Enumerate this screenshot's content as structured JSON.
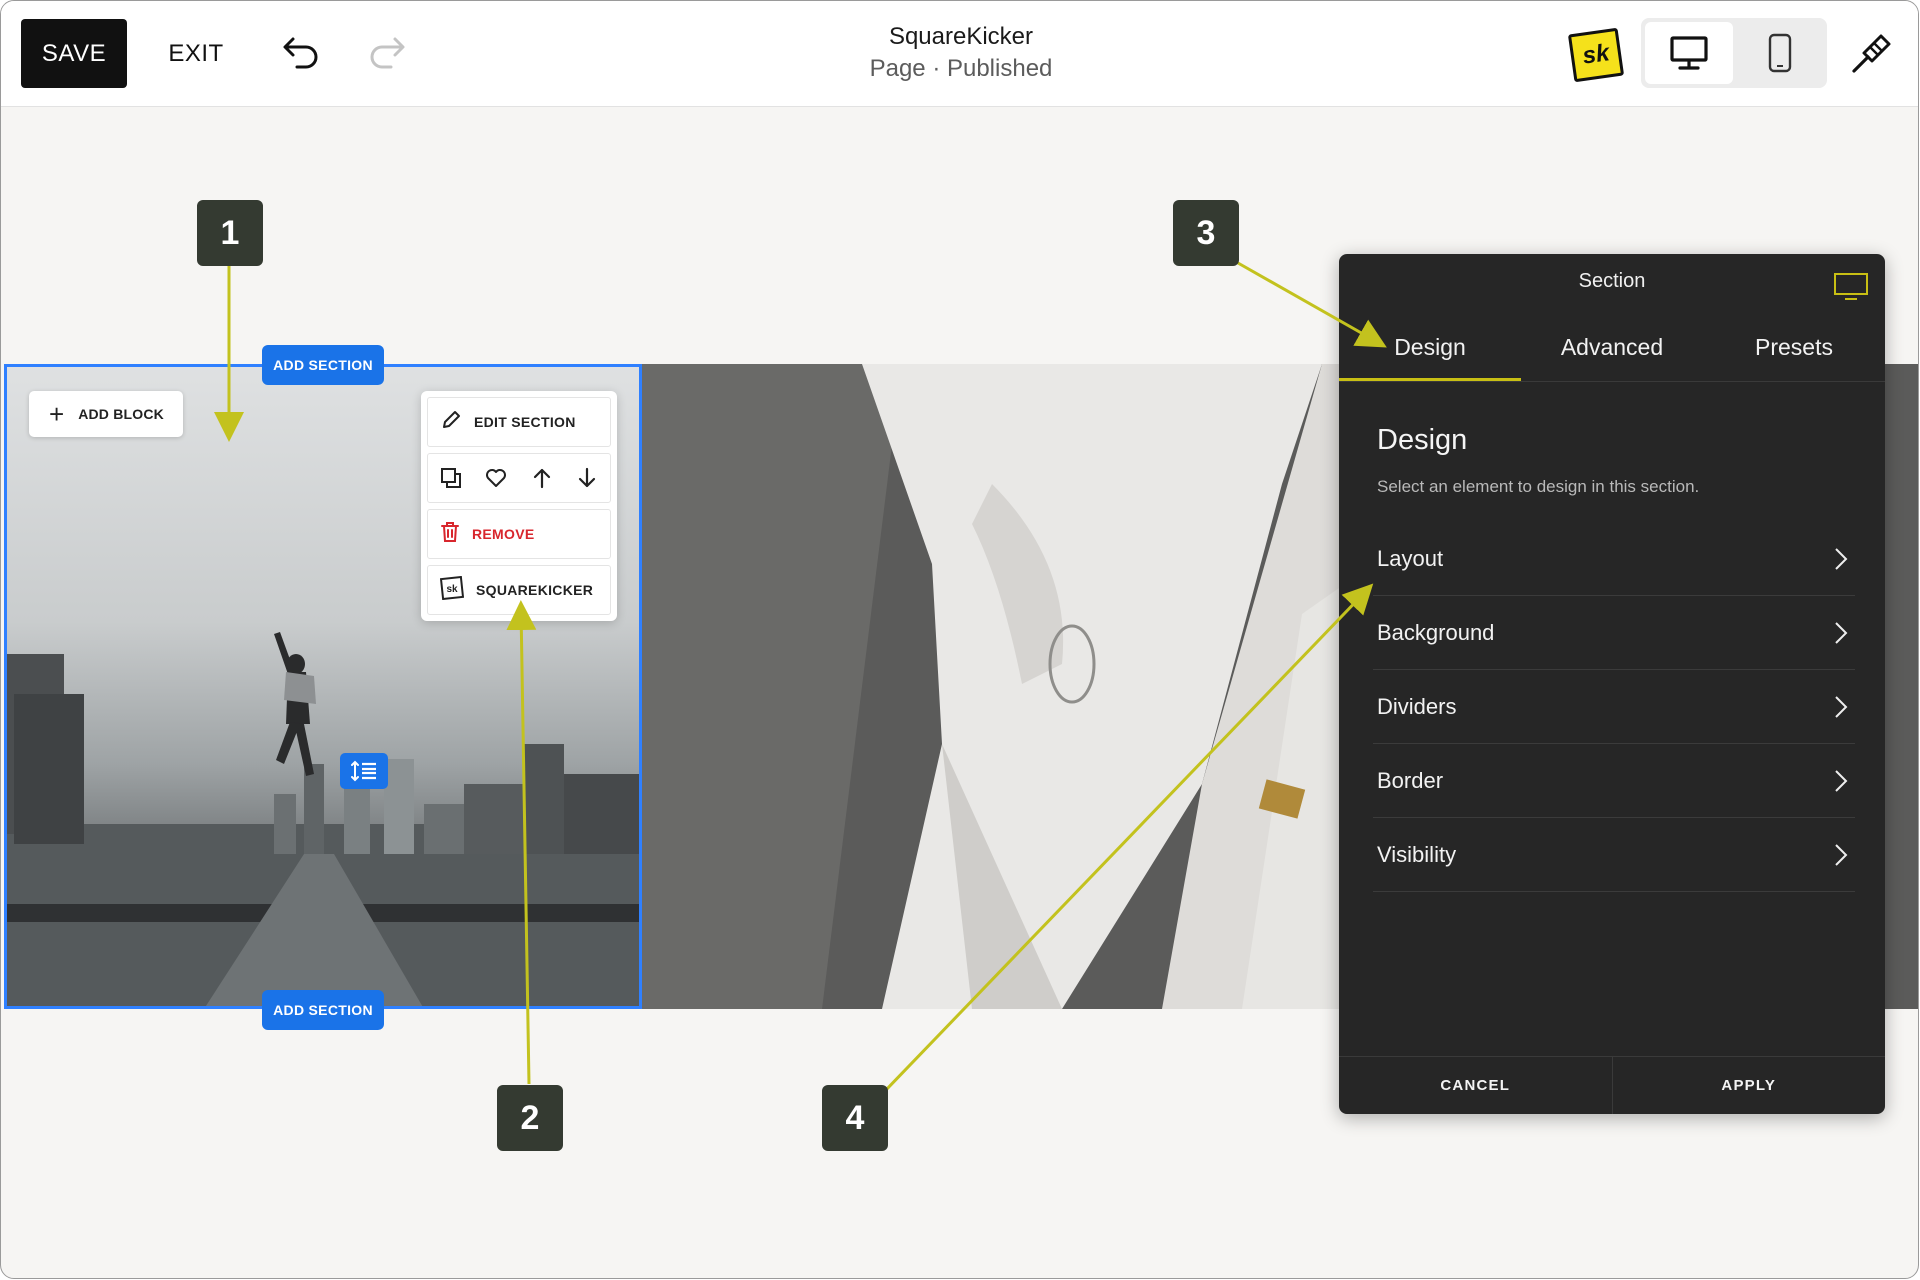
{
  "toolbar": {
    "save_label": "SAVE",
    "exit_label": "EXIT",
    "undo_icon": "undo-icon",
    "redo_icon": "redo-icon",
    "site_title": "SquareKicker",
    "page_status": "Page · Published",
    "logo_text": "sk",
    "device_options": [
      "desktop",
      "mobile"
    ],
    "device_selected": "desktop",
    "style_icon": "paint-brush-icon"
  },
  "canvas": {
    "add_section_label": "ADD SECTION",
    "add_block_label": "ADD BLOCK",
    "section_menu": {
      "edit_label": "EDIT SECTION",
      "icons": [
        "duplicate-icon",
        "heart-icon",
        "arrow-up-icon",
        "arrow-down-icon"
      ],
      "remove_label": "REMOVE",
      "squarekicker_label": "SQUAREKICKER"
    },
    "images": [
      "city-jump-photo",
      "white-sneakers-photo"
    ]
  },
  "panel": {
    "title": "Section",
    "tabs": [
      {
        "label": "Design",
        "active": true
      },
      {
        "label": "Advanced",
        "active": false
      },
      {
        "label": "Presets",
        "active": false
      }
    ],
    "heading": "Design",
    "subtitle": "Select an element to design in this section.",
    "options": [
      "Layout",
      "Background",
      "Dividers",
      "Border",
      "Visibility"
    ],
    "cancel_label": "CANCEL",
    "apply_label": "APPLY"
  },
  "callouts": [
    "1",
    "2",
    "3",
    "4"
  ],
  "colors": {
    "accent_blue": "#1a73e8",
    "panel_bg": "#262626",
    "callout_bg": "#343a31",
    "arrow": "#c3c21e",
    "danger": "#d8262d",
    "logo_yellow": "#f5e11b"
  }
}
